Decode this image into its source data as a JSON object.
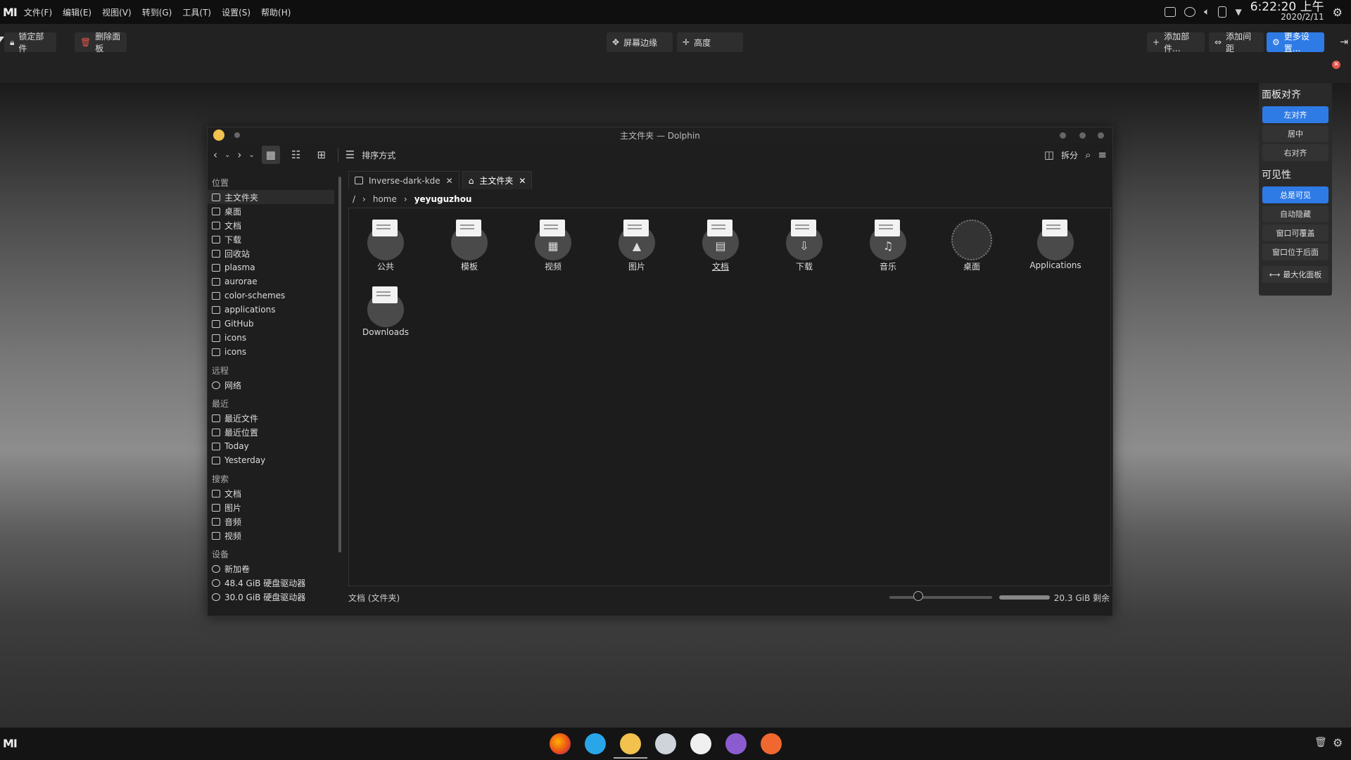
{
  "menubar": {
    "logo": "MI",
    "items": [
      "文件(F)",
      "编辑(E)",
      "视图(V)",
      "转到(G)",
      "工具(T)",
      "设置(S)",
      "帮助(H)"
    ],
    "clock_time": "6:22:20 上午",
    "clock_date": "2020/2/11"
  },
  "panel_edit": {
    "lock": "锁定部件",
    "delete_panel": "删除面板",
    "screen_edge": "屏幕边缘",
    "height": "高度",
    "add_widgets": "添加部件...",
    "add_spacer": "添加间距",
    "more_settings": "更多设置..."
  },
  "panel_options": {
    "align_title": "面板对齐",
    "align_options": [
      "左对齐",
      "居中",
      "右对齐"
    ],
    "align_selected": "左对齐",
    "visibility_title": "可见性",
    "visibility_options": [
      "总是可见",
      "自动隐藏",
      "窗口可覆盖",
      "窗口位于后面"
    ],
    "visibility_selected": "总是可见",
    "maximize": "最大化面板"
  },
  "dolphin": {
    "title": "主文件夹 — Dolphin",
    "sort": "排序方式",
    "split": "拆分",
    "tabs": [
      "Inverse-dark-kde",
      "主文件夹"
    ],
    "breadcrumb": [
      "/",
      "home",
      "yeyuguzhou"
    ],
    "sidebar": {
      "places_title": "位置",
      "places": [
        "主文件夹",
        "桌面",
        "文档",
        "下载",
        "回收站",
        "plasma",
        "aurorae",
        "color-schemes",
        "applications",
        "GitHub",
        "icons",
        "icons"
      ],
      "remote_title": "远程",
      "remote": [
        "网络"
      ],
      "recent_title": "最近",
      "recent": [
        "最近文件",
        "最近位置",
        "Today",
        "Yesterday"
      ],
      "search_title": "搜索",
      "search": [
        "文档",
        "图片",
        "音频",
        "视频"
      ],
      "devices_title": "设备",
      "devices": [
        "新加卷",
        "48.4 GiB 硬盘驱动器",
        "30.0 GiB 硬盘驱动器"
      ]
    },
    "files": [
      {
        "name": "公共",
        "glyph": ""
      },
      {
        "name": "模板",
        "glyph": ""
      },
      {
        "name": "视频",
        "glyph": "▦"
      },
      {
        "name": "图片",
        "glyph": "▲"
      },
      {
        "name": "文档",
        "glyph": "▤"
      },
      {
        "name": "下载",
        "glyph": "⇩"
      },
      {
        "name": "音乐",
        "glyph": "♫"
      },
      {
        "name": "桌面",
        "glyph": ""
      },
      {
        "name": "Applications",
        "glyph": ""
      },
      {
        "name": "Downloads",
        "glyph": ""
      }
    ],
    "status_left": "文档 (文件夹)",
    "status_right": "20.3 GiB 剩余"
  },
  "dock": {
    "left_logo": "MI",
    "apps": [
      "firefox-icon",
      "chat-icon",
      "dolphin-icon",
      "settings-icon",
      "inkscape-icon",
      "github-icon",
      "store-icon"
    ]
  }
}
